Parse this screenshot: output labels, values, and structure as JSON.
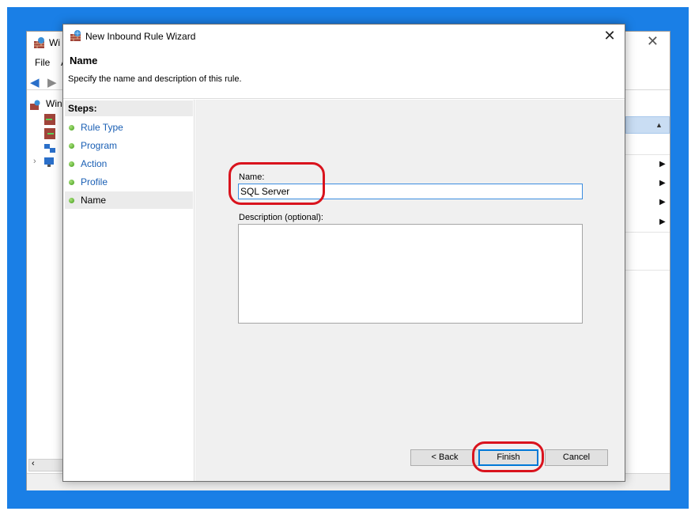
{
  "background_window": {
    "title": "Wi",
    "menu": [
      "File",
      "A"
    ],
    "tree_root": "Win"
  },
  "dialog": {
    "title": "New Inbound Rule Wizard",
    "close_glyph": "✕",
    "header_title": "Name",
    "header_subtitle": "Specify the name and description of this rule."
  },
  "steps": {
    "heading": "Steps:",
    "items": [
      {
        "label": "Rule Type"
      },
      {
        "label": "Program"
      },
      {
        "label": "Action"
      },
      {
        "label": "Profile"
      },
      {
        "label": "Name",
        "current": true
      }
    ]
  },
  "form": {
    "name_label": "Name:",
    "name_value": "SQL Server",
    "description_label": "Description (optional):",
    "description_value": ""
  },
  "buttons": {
    "back": "< Back",
    "finish": "Finish",
    "cancel": "Cancel"
  },
  "colors": {
    "desktop": "#1a7fe6",
    "annotation": "#d9131d",
    "step_link": "#1a5fb4"
  }
}
